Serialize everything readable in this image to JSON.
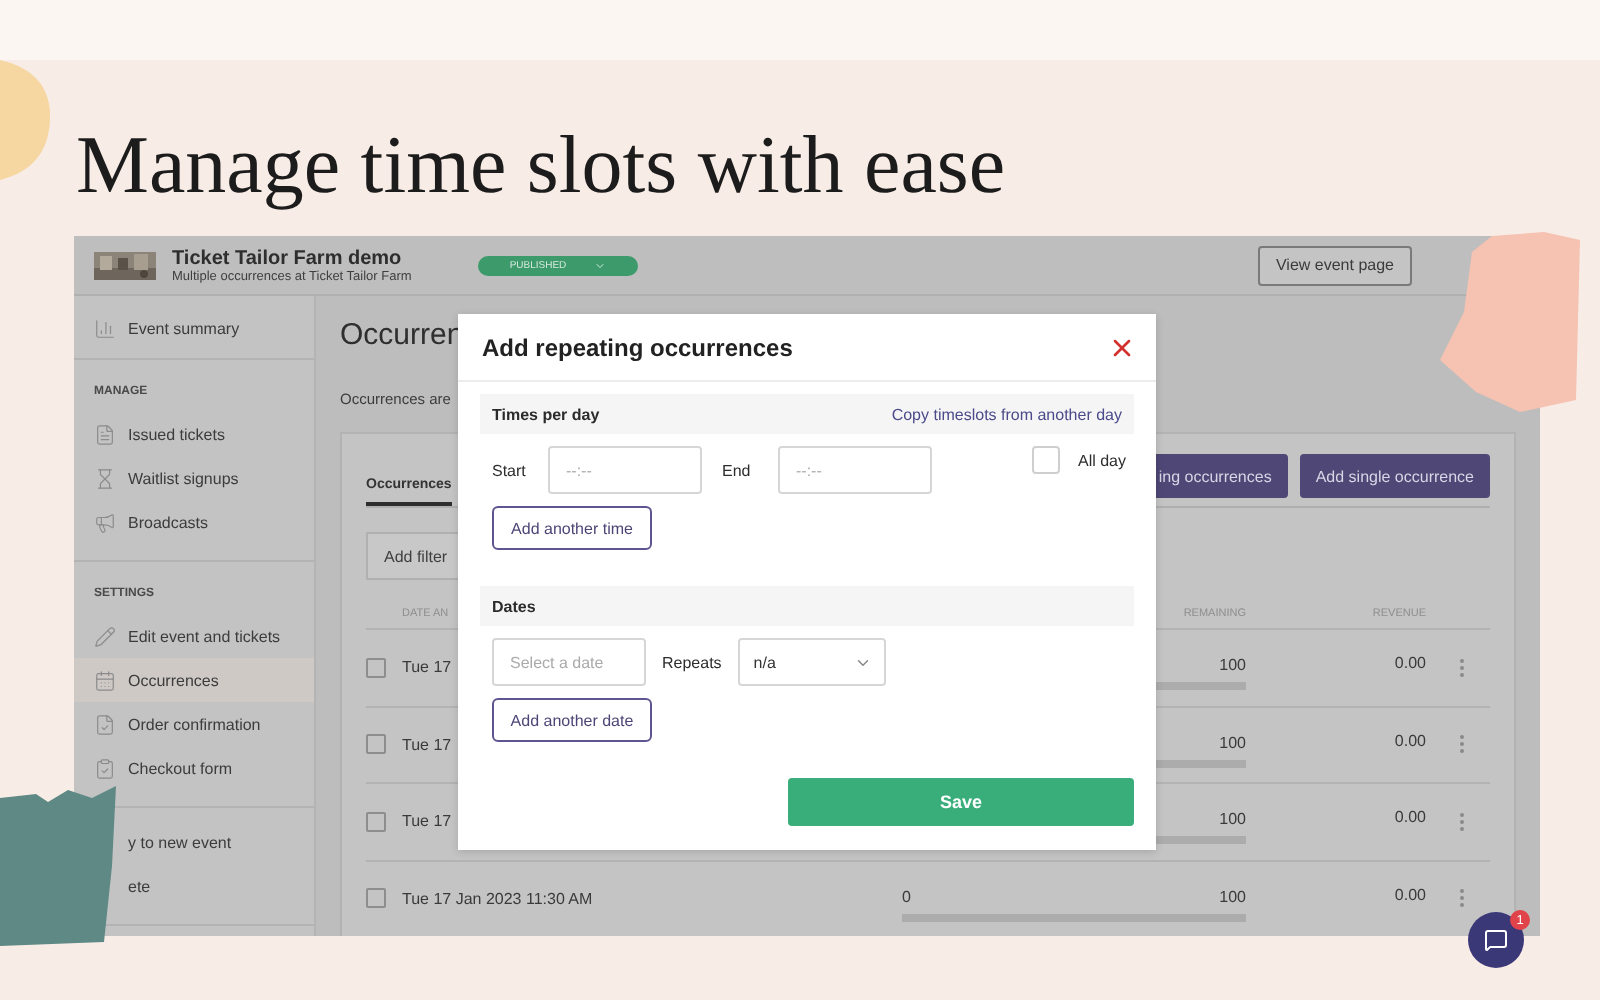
{
  "headline": "Manage time slots with ease",
  "header": {
    "title": "Ticket Tailor Farm demo",
    "subtitle": "Multiple occurrences at Ticket Tailor Farm",
    "status": "PUBLISHED",
    "view_button": "View event page"
  },
  "sidebar": {
    "groups": [
      {
        "items": [
          {
            "label": "Event summary",
            "selected": false
          }
        ]
      },
      {
        "heading": "MANAGE",
        "items": [
          {
            "label": "Issued tickets",
            "selected": false
          },
          {
            "label": "Waitlist signups",
            "selected": false
          },
          {
            "label": "Broadcasts",
            "selected": false
          }
        ]
      },
      {
        "heading": "SETTINGS",
        "items": [
          {
            "label": "Edit event and tickets",
            "selected": false
          },
          {
            "label": "Occurrences",
            "selected": true
          },
          {
            "label": "Order confirmation",
            "selected": false
          },
          {
            "label": "Checkout form",
            "selected": false
          }
        ]
      },
      {
        "items": [
          {
            "label": "y to new event",
            "selected": false
          },
          {
            "label": "ete",
            "selected": false
          }
        ]
      }
    ]
  },
  "main": {
    "heading": "Occurren",
    "intro": "Occurrences are",
    "tab": "Occurrences",
    "buttons": [
      "ing occurrences",
      "Add single occurrence"
    ],
    "filter_placeholder": "Add filter",
    "columns": [
      "DATE AN",
      "REMAINING",
      "REVENUE"
    ],
    "rows": [
      {
        "checked": false,
        "date": "Tue 17",
        "remaining": "100",
        "revenue": "0.00",
        "level": 0
      },
      {
        "checked": false,
        "date": "Tue 17",
        "remaining": "100",
        "revenue": "0.00",
        "level": 0
      },
      {
        "checked": false,
        "date": "Tue 17",
        "remaining": "100",
        "revenue": "0.00",
        "level": 0
      },
      {
        "checked": false,
        "date": "Tue 17 Jan 2023 11:30 AM",
        "sold": "0",
        "remaining": "100",
        "revenue": "0.00",
        "level": 0
      }
    ]
  },
  "modal": {
    "title": "Add repeating occurrences",
    "times": {
      "heading": "Times per day",
      "link": "Copy timeslots from another day",
      "start_label": "Start",
      "start_placeholder": "--:--",
      "end_label": "End",
      "end_placeholder": "--:--",
      "all_day": {
        "label": "All day",
        "checked": false
      },
      "add_button": "Add another time"
    },
    "dates": {
      "heading": "Dates",
      "date_placeholder": "Select a date",
      "repeats_label": "Repeats",
      "repeats_value": "n/a",
      "add_button": "Add another date"
    },
    "save_button": "Save"
  },
  "chat": {
    "badge": "1"
  }
}
